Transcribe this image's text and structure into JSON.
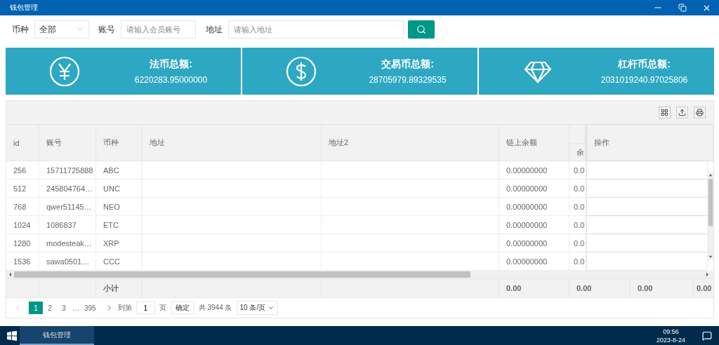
{
  "window": {
    "title": "钱包管理"
  },
  "filters": {
    "currency": {
      "label": "币种",
      "value": "全部"
    },
    "account": {
      "label": "账号",
      "placeholder": "请输入会员账号"
    },
    "address": {
      "label": "地址",
      "placeholder": "请输入地址"
    }
  },
  "cards": [
    {
      "kind": "yen",
      "title": "法币总额:",
      "value": "6220283.95000000"
    },
    {
      "kind": "dollar",
      "title": "交易币总额:",
      "value": "28705979.89329535"
    },
    {
      "kind": "diamond",
      "title": "杠杆币总额:",
      "value": "2031019240.97025806"
    }
  ],
  "table": {
    "columns": [
      "id",
      "账号",
      "币种",
      "地址",
      "地址2",
      "链上余额",
      "余",
      "操作"
    ],
    "rows": [
      {
        "id": "256",
        "account": "15711725888",
        "currency": "ABC",
        "chain_balance": "0.00000000",
        "balance": "0.0"
      },
      {
        "id": "512",
        "account": "245804764…",
        "currency": "UNC",
        "chain_balance": "0.00000000",
        "balance": "0.0"
      },
      {
        "id": "768",
        "account": "qwer51145…",
        "currency": "NEO",
        "chain_balance": "0.00000000",
        "balance": "0.0"
      },
      {
        "id": "1024",
        "account": "1086837",
        "currency": "ETC",
        "chain_balance": "0.00000000",
        "balance": "0.0"
      },
      {
        "id": "1280",
        "account": "modesteak…",
        "currency": "XRP",
        "chain_balance": "0.00000000",
        "balance": "0.0"
      },
      {
        "id": "1536",
        "account": "sawa0501…",
        "currency": "CCC",
        "chain_balance": "0.00000000",
        "balance": "0.0"
      }
    ],
    "subtotal": {
      "label": "小计",
      "values": [
        "0.00",
        "0.00",
        "0.00",
        "0.00"
      ]
    }
  },
  "pagination": {
    "pages": [
      {
        "label": "1",
        "selected": true
      },
      {
        "label": "2",
        "selected": false
      },
      {
        "label": "3",
        "selected": false
      }
    ],
    "ellipsis": "…",
    "last": "395",
    "goto_label": "到第",
    "goto_value": "1",
    "page_unit": "页",
    "confirm": "确定",
    "total": "共 3944 条",
    "page_size": "10 条/页"
  },
  "taskbar": {
    "app": "钱包管理",
    "time": "09:56",
    "date": "2023-8-24"
  }
}
